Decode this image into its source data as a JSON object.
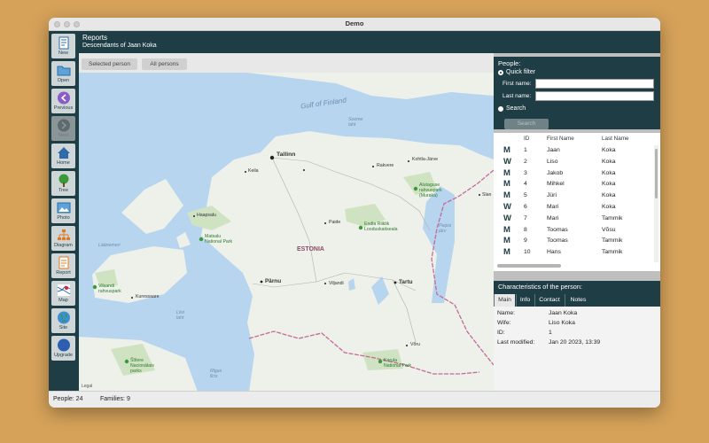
{
  "window": {
    "title": "Demo"
  },
  "sidebar": {
    "items": [
      {
        "label": "New",
        "icon": "new-document-icon"
      },
      {
        "label": "Open",
        "icon": "folder-icon"
      },
      {
        "label": "Previous",
        "icon": "previous-icon"
      },
      {
        "label": "Next",
        "icon": "next-icon"
      },
      {
        "label": "Home",
        "icon": "home-icon"
      },
      {
        "label": "Tree",
        "icon": "tree-icon"
      },
      {
        "label": "Photo",
        "icon": "photo-icon"
      },
      {
        "label": "Diagram",
        "icon": "diagram-icon"
      },
      {
        "label": "Report",
        "icon": "report-icon"
      },
      {
        "label": "Map",
        "icon": "map-icon"
      },
      {
        "label": "Site",
        "icon": "globe-icon"
      },
      {
        "label": "Upgrade",
        "icon": "upgrade-icon"
      }
    ]
  },
  "header": {
    "title": "Reports",
    "subtitle": "Descendants of Jaan Koka"
  },
  "map_toolbar": {
    "selected_person": "Selected person",
    "all_persons": "All persons"
  },
  "map": {
    "labels": {
      "gulf": "Gulf of Finland",
      "soome_laht": "Soome\nlaht",
      "tallinn": "Tallinn",
      "kohtla": "Kohtla-Järve",
      "rakvere": "Rakvere",
      "keila": "Keila",
      "alutaguse": "Alutaguse\nrahvuspark\n(Muraka)",
      "slan": "Slan",
      "haapsalu": "Haapsalu",
      "matsalu": "Matsalu\nNational Park",
      "paide": "Paide",
      "endla": "Endla Riiklik\nLooduskaitseala",
      "peipsi": "Peipsi\njärv",
      "laanemeri": "Läänemeri",
      "estonia": "ESTONIA",
      "vilsandi": "Vilsandi\nrahvuspark",
      "parnu": "Pärnu",
      "viljandi": "Viljandi",
      "tartu": "Tartu",
      "kuressaare": "Kuressaare",
      "liivi": "Liivi\nlaht",
      "voru": "Võru",
      "sitlaces": "Šlītere\nNacionālais\nparks",
      "karula": "Karula\nNational Park",
      "rigas": "Rīgas\nlīcis",
      "legal": "Legal"
    }
  },
  "people_panel": {
    "title": "People:",
    "quick_filter": "Quick filter",
    "first_name_label": "First name:",
    "last_name_label": "Last name:",
    "search_radio": "Search",
    "search_button": "Search",
    "first_name_value": "",
    "last_name_value": ""
  },
  "table": {
    "headers": [
      "ID",
      "First Name",
      "Last Name"
    ],
    "rows": [
      {
        "g": "M",
        "id": "1",
        "first": "Jaan",
        "last": "Koka"
      },
      {
        "g": "W",
        "id": "2",
        "first": "Liso",
        "last": "Koka"
      },
      {
        "g": "M",
        "id": "3",
        "first": "Jakob",
        "last": "Koka"
      },
      {
        "g": "M",
        "id": "4",
        "first": "Mihkel",
        "last": "Koka"
      },
      {
        "g": "M",
        "id": "5",
        "first": "Jüri",
        "last": "Koka"
      },
      {
        "g": "W",
        "id": "6",
        "first": "Mari",
        "last": "Koka"
      },
      {
        "g": "W",
        "id": "7",
        "first": "Mari",
        "last": "Tammik"
      },
      {
        "g": "M",
        "id": "8",
        "first": "Toomas",
        "last": "Võsu"
      },
      {
        "g": "M",
        "id": "9",
        "first": "Toomas",
        "last": "Tammik"
      },
      {
        "g": "M",
        "id": "10",
        "first": "Hans",
        "last": "Tammik"
      }
    ]
  },
  "characteristics": {
    "title": "Characteristics of the person:",
    "tabs": [
      "Main",
      "Info",
      "Contact",
      "Notes"
    ],
    "fields": [
      {
        "label": "Name:",
        "value": "Jaan Koka"
      },
      {
        "label": "Wife:",
        "value": "Liso Koka"
      },
      {
        "label": "ID:",
        "value": "1"
      },
      {
        "label": "Last modified:",
        "value": "Jan 20 2023, 13:39"
      }
    ]
  },
  "status": {
    "people": "People: 24",
    "families": "Families: 9"
  },
  "colors": {
    "panel": "#1f3d45",
    "background": "#d6a25a",
    "water": "#b7d5ee",
    "land": "#eef0ea",
    "park": "#cfe3c3"
  }
}
